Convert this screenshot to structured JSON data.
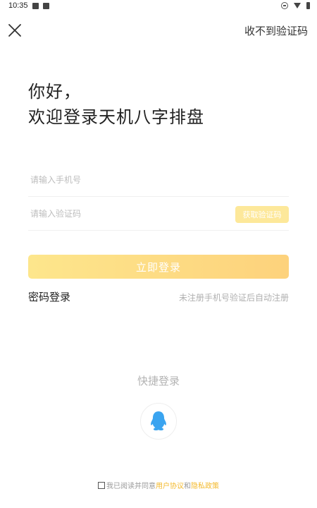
{
  "status_bar": {
    "time": "10:35",
    "icons": [
      "image-icon",
      "notification-icon",
      "do-not-disturb-icon",
      "wifi-icon",
      "battery-icon"
    ]
  },
  "top_bar": {
    "close_icon": "close-icon",
    "no_code_label": "收不到验证码"
  },
  "greeting": {
    "line1": "你好，",
    "line2": "欢迎登录天机八字排盘"
  },
  "form": {
    "phone_placeholder": "请输入手机号",
    "phone_value": "",
    "code_placeholder": "请输入验证码",
    "code_value": "",
    "get_code_label": "获取验证码",
    "login_label": "立即登录"
  },
  "links": {
    "password_login": "密码登录",
    "auto_register_note": "未注册手机号验证后自动注册"
  },
  "quick_login": {
    "title": "快捷登录",
    "qq_icon": "qq-icon"
  },
  "agreement": {
    "prefix": "我已阅读并同意",
    "user_agreement": "用户协议",
    "and": "和",
    "privacy_policy": "隐私政策"
  },
  "colors": {
    "accent": "#fdd27c",
    "accent_light": "#fde89a",
    "link": "#f3b92c",
    "qq_blue": "#3aa4f0"
  }
}
